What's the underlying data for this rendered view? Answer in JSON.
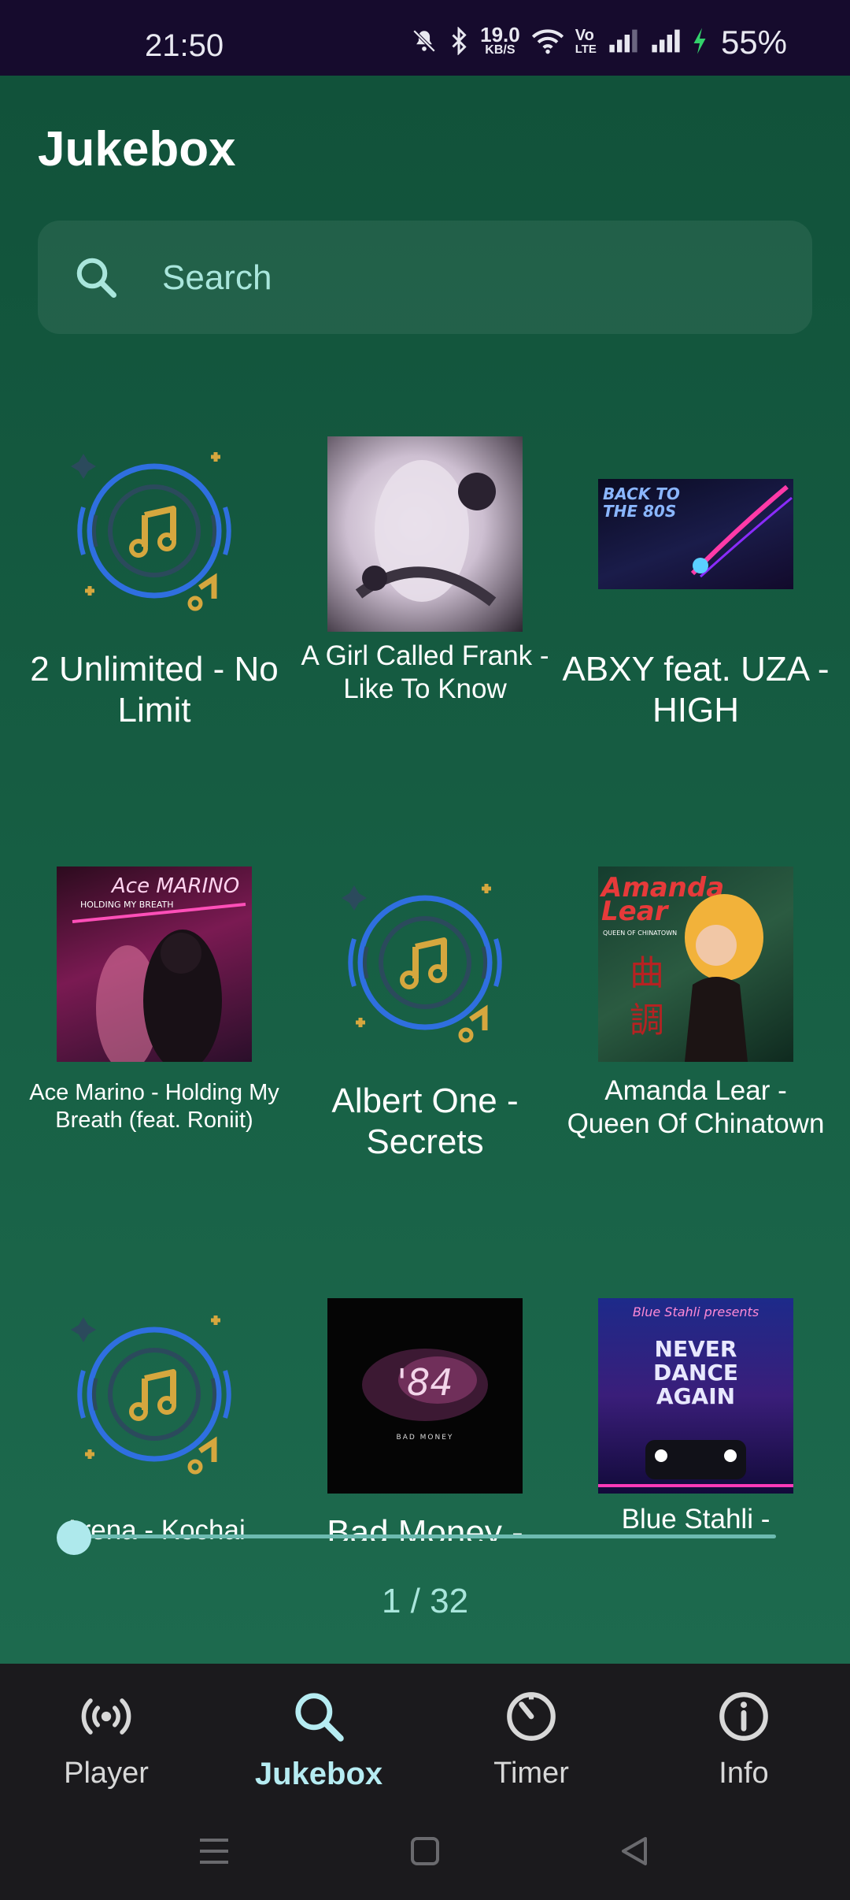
{
  "status_bar": {
    "time": "21:50",
    "net_speed_value": "19.0",
    "net_speed_unit": "KB/S",
    "volte_top": "Vo",
    "volte_bottom": "LTE",
    "battery": "55%",
    "icons": [
      "mute-icon",
      "bluetooth-icon",
      "wifi-icon",
      "volte-icon",
      "signal-icon",
      "signal-icon",
      "charging-icon"
    ]
  },
  "page": {
    "title": "Jukebox"
  },
  "search": {
    "placeholder": "Search"
  },
  "tracks": [
    {
      "label": "2 Unlimited - No Limit",
      "art": "placeholder"
    },
    {
      "label": "A Girl Called Frank - Like To Know",
      "art": "cover"
    },
    {
      "label": "ABXY feat. UZA - HIGH",
      "art": "cover",
      "cover_text": "BACK TO THE 80S"
    },
    {
      "label": "Ace Marino - Holding My Breath (feat. Roniit)",
      "art": "cover",
      "cover_text": "Ace MARINO",
      "cover_subtext": "HOLDING MY BREATH"
    },
    {
      "label": "Albert One - Secrets",
      "art": "placeholder"
    },
    {
      "label": "Amanda Lear - Queen Of Chinatown",
      "art": "cover",
      "cover_text": "Amanda Lear",
      "cover_subtext": "QUEEN OF CHINATOWN"
    },
    {
      "label": "Arena - Kochai",
      "art": "placeholder"
    },
    {
      "label": "Bad Money -",
      "art": "cover",
      "cover_text": "'84",
      "cover_subtext": "BAD MONEY"
    },
    {
      "label": "Blue Stahli -",
      "art": "cover",
      "cover_text": "NEVER DANCE AGAIN",
      "cover_subtext": "Blue Stahli presents"
    }
  ],
  "slider": {
    "value": 1
  },
  "pager": {
    "text": "1 / 32",
    "current": 1,
    "total": 32
  },
  "bottom_nav": {
    "active": "Jukebox",
    "items": [
      {
        "label": "Player",
        "icon": "broadcast-icon"
      },
      {
        "label": "Jukebox",
        "icon": "search-icon"
      },
      {
        "label": "Timer",
        "icon": "timer-icon"
      },
      {
        "label": "Info",
        "icon": "info-icon"
      }
    ]
  },
  "colors": {
    "status_bar": "#160b2d",
    "background": "#175f44",
    "accent": "#a9e6dc",
    "nav_active": "#b6ecf2",
    "nav_bar": "#1b1a1d",
    "placeholder_ring": "#2f6fe0",
    "placeholder_note": "#d6a73e"
  }
}
